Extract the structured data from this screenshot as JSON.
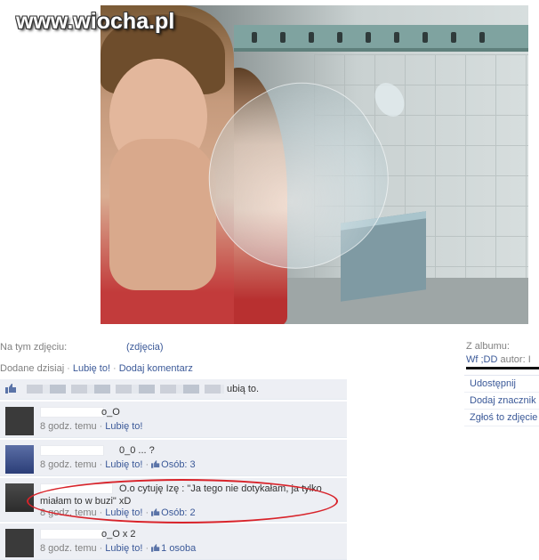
{
  "watermark": "www.wiocha.pl",
  "photo_meta": {
    "on_photo_label": "Na tym zdjęciu:",
    "tag_label": "(zdjęcia)"
  },
  "actions_line": {
    "added": "Dodane dzisiaj",
    "like": "Lubię to!",
    "comment": "Dodaj komentarz"
  },
  "album": {
    "from_label": "Z albumu:",
    "name": "Wf ;DD",
    "author_label": "autor: I",
    "actions": [
      "Udostępnij",
      "Dodaj znacznik",
      "Zgłoś to zdjęcie"
    ]
  },
  "likes_summary": {
    "text": "ubią to."
  },
  "comments": [
    {
      "text": "o_O",
      "time": "8 godz. temu",
      "like": "Lubię to!",
      "count_text": ""
    },
    {
      "text": "0_0 ... ?",
      "time": "8 godz. temu",
      "like": "Lubię to!",
      "count_text": "Osób: 3"
    },
    {
      "text": "O.o cytuję Izę : \"Ja tego nie dotykałam, ja tylko",
      "text2": "miałam to w buzi\" xD",
      "time": "8 godz. temu",
      "like": "Lubię to!",
      "count_text": "Osób: 2"
    },
    {
      "text": "o_O x 2",
      "time": "8 godz. temu",
      "like": "Lubię to!",
      "count_text": "1 osoba"
    }
  ],
  "colors": {
    "link": "#3b5998",
    "meta_gray": "#808080",
    "comment_bg": "#edeff4",
    "highlight": "#d8232a"
  }
}
